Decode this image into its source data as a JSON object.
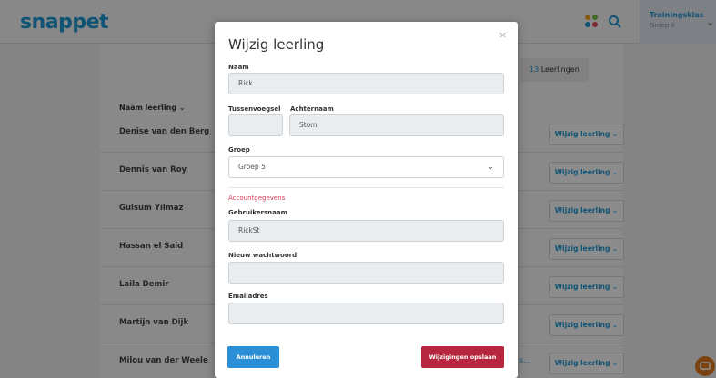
{
  "brand": {
    "logo": "snappet",
    "accent": "#1e9ad6"
  },
  "header": {
    "class_name": "Trainingsklas",
    "class_sub": "Groep 6",
    "icons": [
      "apps-icon",
      "search-icon",
      "chevron-down-icon"
    ]
  },
  "list": {
    "count_number": "13",
    "count_label": " Leerlingen",
    "column_header": "Naam leerling",
    "row_button_label": "Wijzig leerling",
    "row_extra": "s...",
    "students": [
      "Denise van den Berg",
      "Dennis van Roy",
      "Gülsüm Yilmaz",
      "Hassan el Said",
      "Laila Demir",
      "Martijn van Dijk",
      "Milou van der Weele"
    ]
  },
  "modal": {
    "title": "Wijzig leerling",
    "close_glyph": "×",
    "first_name_label": "Naam",
    "first_name_value": "Rick",
    "infix_label": "Tussenvoegsel",
    "infix_value": "",
    "last_name_label": "Achternaam",
    "last_name_value": "Stom",
    "group_label": "Groep",
    "group_value": "Groep 5",
    "account_section": "Accountgegevens",
    "username_label": "Gebruikersnaam",
    "username_value": "RickSt",
    "password_label": "Nieuw wachtwoord",
    "password_value": "",
    "email_label": "Emailadres",
    "email_value": "",
    "cancel_label": "Annuleren",
    "save_label": "Wijzigingen opslaan",
    "save_color": "#b7263f",
    "cancel_color": "#2a8fd6"
  }
}
